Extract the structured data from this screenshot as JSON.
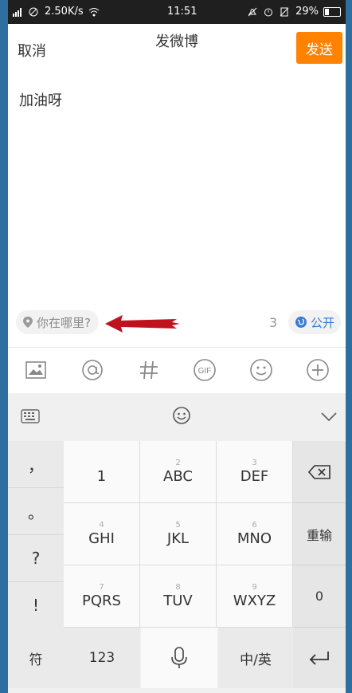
{
  "status": {
    "network_speed": "2.50K/s",
    "time": "11:51",
    "battery": "29%",
    "battery_level": 0.29
  },
  "header": {
    "cancel_label": "取消",
    "title": "发微博",
    "send_label": "发送",
    "send_color": "#ff8200"
  },
  "compose": {
    "text": "加油呀"
  },
  "meta": {
    "location_label": "你在哪里?",
    "char_count": "3",
    "visibility_label": "公开",
    "accent": "#3a7bd5"
  },
  "toolbar": {
    "icons": [
      "image-icon",
      "at-icon",
      "hashtag-icon",
      "gif-icon",
      "emoji-icon",
      "add-icon"
    ]
  },
  "keyboard": {
    "symbols": [
      "，",
      "。",
      "?",
      "!"
    ],
    "keys": [
      {
        "sub": "",
        "main": "1"
      },
      {
        "sub": "2",
        "main": "ABC"
      },
      {
        "sub": "3",
        "main": "DEF"
      },
      {
        "sub": "4",
        "main": "GHI"
      },
      {
        "sub": "5",
        "main": "JKL"
      },
      {
        "sub": "6",
        "main": "MNO"
      },
      {
        "sub": "7",
        "main": "PQRS"
      },
      {
        "sub": "8",
        "main": "TUV"
      },
      {
        "sub": "9",
        "main": "WXYZ"
      }
    ],
    "right": {
      "retype": "重输",
      "zero": "0"
    },
    "bottom": {
      "symbol": "符",
      "numbers": "123",
      "lang": "中/英"
    }
  }
}
